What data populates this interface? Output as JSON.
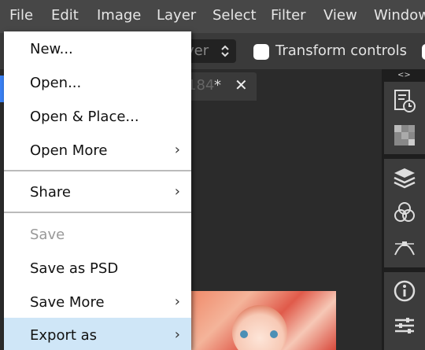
{
  "menubar": {
    "items": [
      "File",
      "Edit",
      "Image",
      "Layer",
      "Select",
      "Filter",
      "View",
      "Window"
    ]
  },
  "options_bar": {
    "layer_select_value": "yer",
    "transform_controls_label": "Transform controls"
  },
  "document_tab": {
    "name": "184",
    "modified_marker": "*",
    "close_glyph": "✕"
  },
  "panel": {
    "collapse_arrows": "<>"
  },
  "file_menu": {
    "items": [
      {
        "label": "New...",
        "submenu": false,
        "disabled": false
      },
      {
        "label": "Open...",
        "submenu": false,
        "disabled": false
      },
      {
        "label": "Open & Place...",
        "submenu": false,
        "disabled": false
      },
      {
        "label": "Open More",
        "submenu": true,
        "disabled": false
      },
      {
        "label": "Share",
        "submenu": true,
        "disabled": false
      },
      {
        "label": "Save",
        "submenu": false,
        "disabled": true
      },
      {
        "label": "Save as PSD",
        "submenu": false,
        "disabled": false
      },
      {
        "label": "Save More",
        "submenu": true,
        "disabled": false
      },
      {
        "label": "Export as",
        "submenu": true,
        "disabled": false,
        "highlighted": true
      }
    ],
    "submenu_arrow": "›"
  },
  "colors": {
    "menubar_bg": "#474747",
    "menu_bg": "#ffffff",
    "highlight": "#cfe6f7",
    "accent": "#3b82f6"
  }
}
